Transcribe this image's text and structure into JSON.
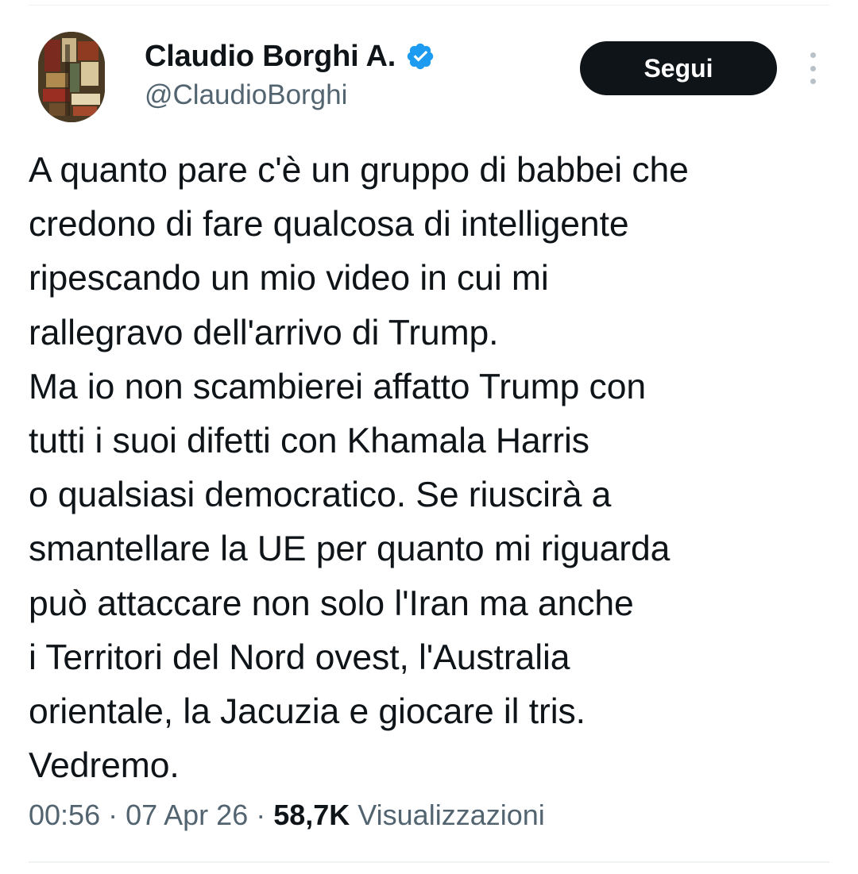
{
  "author": {
    "display_name": "Claudio Borghi A.",
    "handle": "@ClaudioBorghi",
    "verified": true
  },
  "actions": {
    "follow_label": "Segui",
    "more_icon": "more-vertical-icon"
  },
  "tweet": {
    "lines": [
      "A quanto pare c'è un gruppo di babbei che",
      "credono di fare qualcosa di intelligente",
      "ripescando un mio video in cui mi",
      "rallegravo dell'arrivo di Trump.",
      "Ma io non scambierei affatto Trump con",
      "tutti i suoi difetti con Khamala Harris",
      "o qualsiasi democratico. Se riuscirà a",
      "smantellare la UE per quanto mi riguarda",
      "può attaccare non solo l'Iran ma anche",
      "i Territori del Nord ovest, l'Australia",
      "orientale, la Jacuzia e giocare il tris.",
      "Vedremo."
    ]
  },
  "meta": {
    "time": "00:56",
    "separator": " · ",
    "date": "07 Apr 26",
    "views_count": "58,7K",
    "views_label": " Visualizzazioni"
  },
  "colors": {
    "text_primary": "#0f1419",
    "text_secondary": "#536471",
    "verified_blue": "#1d9bf0",
    "button_bg": "#0f1419",
    "divider": "#eff3f4"
  }
}
